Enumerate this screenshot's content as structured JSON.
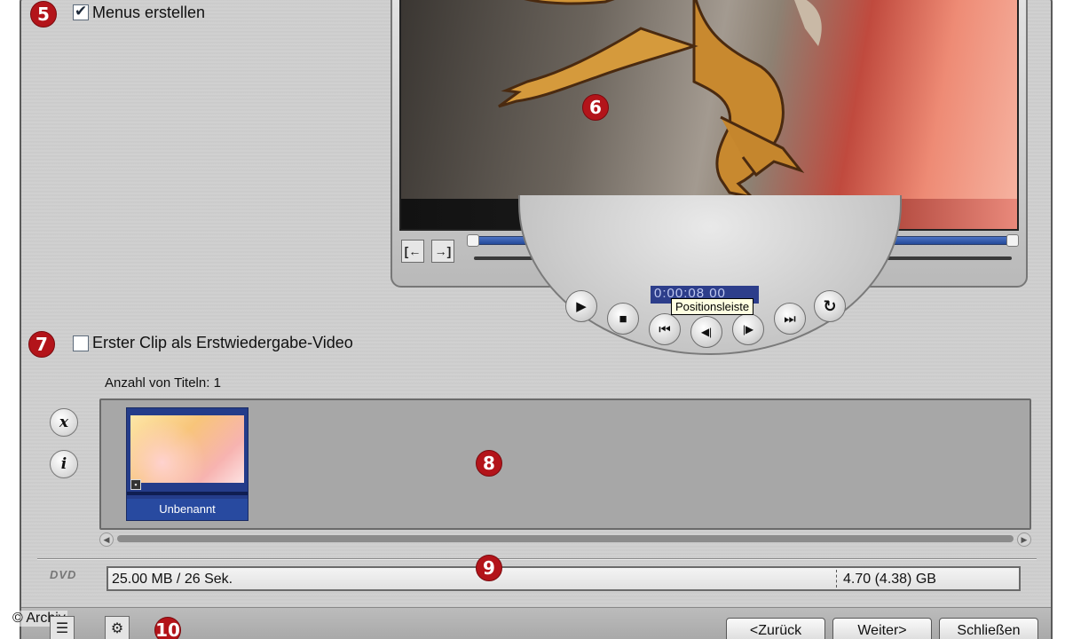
{
  "markers": {
    "m5": "5",
    "m6": "6",
    "m7": "7",
    "m8": "8",
    "m9": "9",
    "m10": "10"
  },
  "menus_checkbox": {
    "label": "Menus erstellen",
    "checked": true
  },
  "first_clip_checkbox": {
    "label": "Erster Clip als Erstwiedergabe-Video",
    "checked": false
  },
  "player": {
    "timecode": "0:00:08 00",
    "tooltip": "Positionsleiste",
    "buttons": {
      "play": "▶",
      "stop": "■",
      "skip_start": "⏮",
      "step_back": "◀|",
      "step_fwd": "|▶",
      "skip_end": "⏭",
      "loop": "↻",
      "mark_in": "[←",
      "mark_out": "→]"
    }
  },
  "titles": {
    "count_label": "Anzahl von Titeln: 1",
    "items": [
      {
        "name": "Unbenannt"
      }
    ],
    "delete_icon": "x",
    "info_icon": "i"
  },
  "disc": {
    "logo": "DVD",
    "used": "25.00 MB / 26 Sek.",
    "capacity": "4.70 (4.38) GB"
  },
  "footer": {
    "copyright": "© Archiv",
    "back": "<Zurück",
    "next": "Weiter>",
    "close": "Schließen",
    "list_icon": "☰",
    "settings_icon": "⚙"
  }
}
